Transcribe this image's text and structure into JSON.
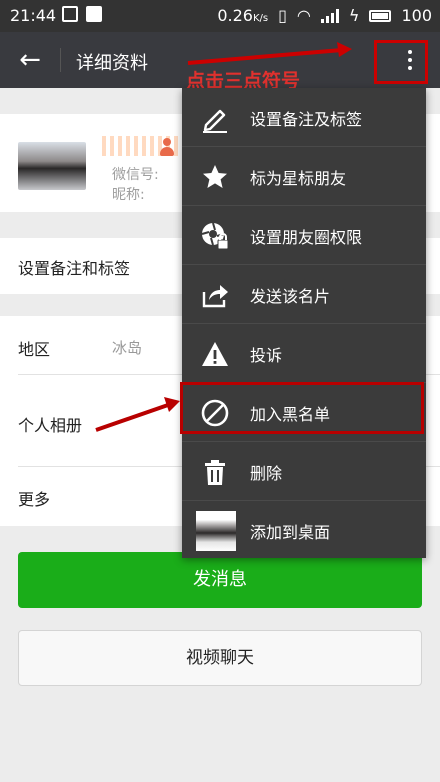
{
  "status": {
    "time": "21:44",
    "net": "0.26",
    "net_unit": "K/s",
    "battery": "100"
  },
  "titlebar": {
    "title": "详细资料"
  },
  "annotation_top": "点击三点符号",
  "profile": {
    "wechat_id_label": "微信号:",
    "nickname_label": "昵称:"
  },
  "rows": {
    "remark_tags": "设置备注和标签",
    "region_label": "地区",
    "region_value": "冰岛",
    "album_label": "个人相册",
    "more_label": "更多"
  },
  "buttons": {
    "send_message": "发消息",
    "video_chat": "视频聊天"
  },
  "menu": {
    "items": [
      {
        "label": "设置备注及标签",
        "icon": "pencil-icon"
      },
      {
        "label": "标为星标朋友",
        "icon": "star-icon"
      },
      {
        "label": "设置朋友圈权限",
        "icon": "aperture-lock-icon"
      },
      {
        "label": "发送该名片",
        "icon": "share-icon"
      },
      {
        "label": "投诉",
        "icon": "warning-icon"
      },
      {
        "label": "加入黑名单",
        "icon": "block-icon"
      },
      {
        "label": "删除",
        "icon": "trash-icon"
      },
      {
        "label": "添加到桌面",
        "icon": "avatar-icon"
      }
    ]
  },
  "colors": {
    "titlebar": "#393a3f",
    "send_button": "#1aad19",
    "annotation": "#cc0000"
  }
}
